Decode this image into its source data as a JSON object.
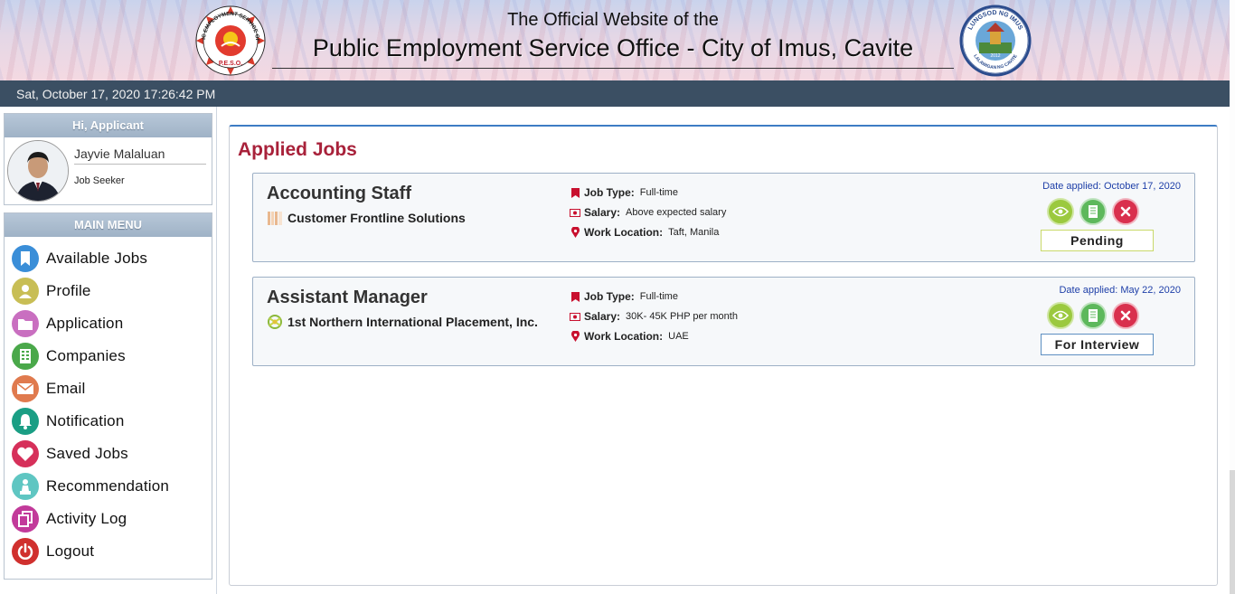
{
  "header": {
    "title_line1": "The Official Website of the",
    "title_line2": "Public Employment Service Office - City of Imus, Cavite",
    "left_logo": {
      "name": "peso-logo",
      "ring_text": "PUBLIC EMPLOYMENT SERVICE OFFICE",
      "bottom_text": "P.E.S.O."
    },
    "right_logo": {
      "name": "imus-city-seal",
      "ring_text": "LUNGSOD NG IMUS",
      "bottom_text": "LALAWIGAN NG CAVITE",
      "year": "2012"
    }
  },
  "datebar": {
    "datetime": "Sat, October 17, 2020 17:26:42 PM"
  },
  "user_panel": {
    "heading": "Hi, Applicant",
    "name": "Jayvie Malaluan",
    "role": "Job Seeker"
  },
  "menu": {
    "heading": "MAIN MENU",
    "items": [
      {
        "label": "Available Jobs",
        "icon": "bookmark-icon",
        "color": "#3a8ed8"
      },
      {
        "label": "Profile",
        "icon": "user-icon",
        "color": "#c8be55"
      },
      {
        "label": "Application",
        "icon": "folder-icon",
        "color": "#c96fc0"
      },
      {
        "label": "Companies",
        "icon": "building-icon",
        "color": "#4aa84a"
      },
      {
        "label": "Email",
        "icon": "envelope-icon",
        "color": "#e07a4e"
      },
      {
        "label": "Notification",
        "icon": "bell-icon",
        "color": "#1a9e84"
      },
      {
        "label": "Saved Jobs",
        "icon": "heart-icon",
        "color": "#d6305a"
      },
      {
        "label": "Recommendation",
        "icon": "chess-pawn-icon",
        "color": "#5fc6c2"
      },
      {
        "label": "Activity Log",
        "icon": "copy-icon",
        "color": "#c23a9a"
      },
      {
        "label": "Logout",
        "icon": "power-icon",
        "color": "#d0302e"
      }
    ]
  },
  "main": {
    "title": "Applied Jobs",
    "detail_labels": {
      "job_type": "Job Type:",
      "salary": "Salary:",
      "location": "Work Location:"
    },
    "jobs": [
      {
        "title": "Accounting Staff",
        "company": "Customer Frontline Solutions",
        "job_type": "Full-time",
        "salary": "Above expected salary",
        "location": "Taft, Manila",
        "date_applied": "Date applied: October 17, 2020",
        "status": "Pending"
      },
      {
        "title": "Assistant Manager",
        "company": "1st Northern International Placement, Inc.",
        "job_type": "Full-time",
        "salary": "30K- 45K PHP per month",
        "location": "UAE",
        "date_applied": "Date applied: May 22, 2020",
        "status": "For Interview"
      }
    ]
  },
  "colors": {
    "accent_red": "#a8213a",
    "datebar": "#3b4f63",
    "link_blue": "#1e3fa8"
  }
}
